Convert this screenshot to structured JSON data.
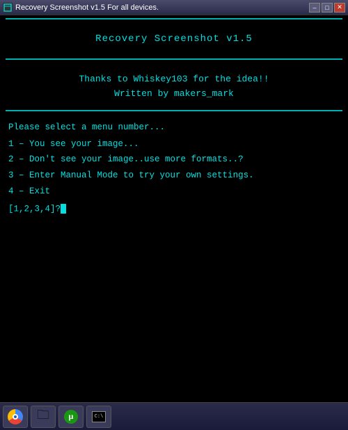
{
  "titlebar": {
    "title": "Recovery Screenshot v1.5 For all devices.",
    "minimize": "–",
    "maximize": "□",
    "close": "✕"
  },
  "terminal": {
    "header_title": "Recovery Screenshot v1.5",
    "thanks_line1": "Thanks to Whiskey103 for the idea!!",
    "thanks_line2": "Written by makers_mark",
    "menu_prompt": "Please select a menu number...",
    "items": [
      {
        "key": "1",
        "label": "You see your image..."
      },
      {
        "key": "2",
        "label": "Don't see your image..use more formats..?"
      },
      {
        "key": "3",
        "label": "Enter Manual Mode to try your own settings."
      },
      {
        "key": "4",
        "label": "Exit"
      }
    ],
    "input_prompt": "[1,2,3,4]?"
  },
  "taskbar": {
    "items": [
      {
        "name": "chrome",
        "label": "Chrome"
      },
      {
        "name": "explorer",
        "label": "Windows Explorer"
      },
      {
        "name": "utorrent",
        "label": "uTorrent"
      },
      {
        "name": "cmd",
        "label": "Command Prompt"
      }
    ]
  }
}
